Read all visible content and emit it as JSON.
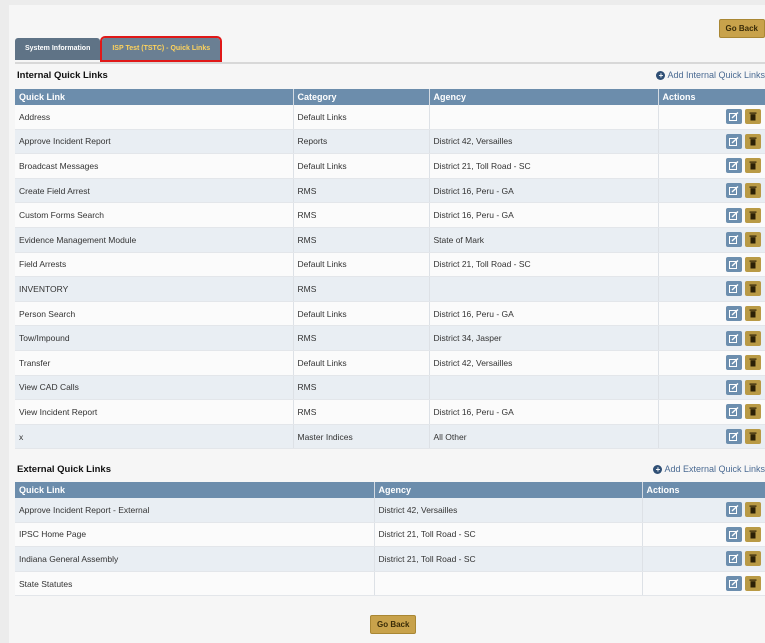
{
  "go_back_label": "Go Back",
  "tabs": [
    "System Information",
    "ISP Test (TSTC) - Quick Links"
  ],
  "internal": {
    "title": "Internal Quick Links",
    "add_label": "Add Internal Quick Links",
    "headers": [
      "Quick Link",
      "Category",
      "Agency",
      "Actions"
    ],
    "rows": [
      {
        "link": "Address",
        "category": "Default Links",
        "agency": ""
      },
      {
        "link": "Approve Incident Report",
        "category": "Reports",
        "agency": "District 42, Versailles"
      },
      {
        "link": "Broadcast Messages",
        "category": "Default Links",
        "agency": "District 21, Toll Road - SC"
      },
      {
        "link": "Create Field Arrest",
        "category": "RMS",
        "agency": "District 16, Peru - GA"
      },
      {
        "link": "Custom Forms Search",
        "category": "RMS",
        "agency": "District 16, Peru - GA"
      },
      {
        "link": "Evidence Management Module",
        "category": "RMS",
        "agency": "State of Mark"
      },
      {
        "link": "Field Arrests",
        "category": "Default Links",
        "agency": "District 21, Toll Road - SC"
      },
      {
        "link": "INVENTORY",
        "category": "RMS",
        "agency": ""
      },
      {
        "link": "Person Search",
        "category": "Default Links",
        "agency": "District 16, Peru - GA"
      },
      {
        "link": "Tow/Impound",
        "category": "RMS",
        "agency": "District 34, Jasper"
      },
      {
        "link": "Transfer",
        "category": "Default Links",
        "agency": "District 42, Versailles"
      },
      {
        "link": "View CAD Calls",
        "category": "RMS",
        "agency": ""
      },
      {
        "link": "View Incident Report",
        "category": "RMS",
        "agency": "District 16, Peru - GA"
      },
      {
        "link": "x",
        "category": "Master Indices",
        "agency": "All Other"
      }
    ]
  },
  "external": {
    "title": "External Quick Links",
    "add_label": "Add External Quick Links",
    "headers": [
      "Quick Link",
      "Agency",
      "Actions"
    ],
    "rows": [
      {
        "link": "Approve Incident Report - External",
        "agency": "District 42, Versailles"
      },
      {
        "link": "IPSC Home Page",
        "agency": "District 21, Toll Road - SC"
      },
      {
        "link": "Indiana General Assembly",
        "agency": "District 21, Toll Road - SC"
      },
      {
        "link": "State Statutes",
        "agency": ""
      }
    ]
  },
  "icons": {
    "edit": "edit-icon",
    "delete": "trash-icon",
    "add": "plus-circle-icon"
  },
  "colors": {
    "header": "#6c8dac",
    "gold_button": "#c8a24b",
    "edit_button": "#6c8eae",
    "active_tab_outline": "#e01818"
  }
}
